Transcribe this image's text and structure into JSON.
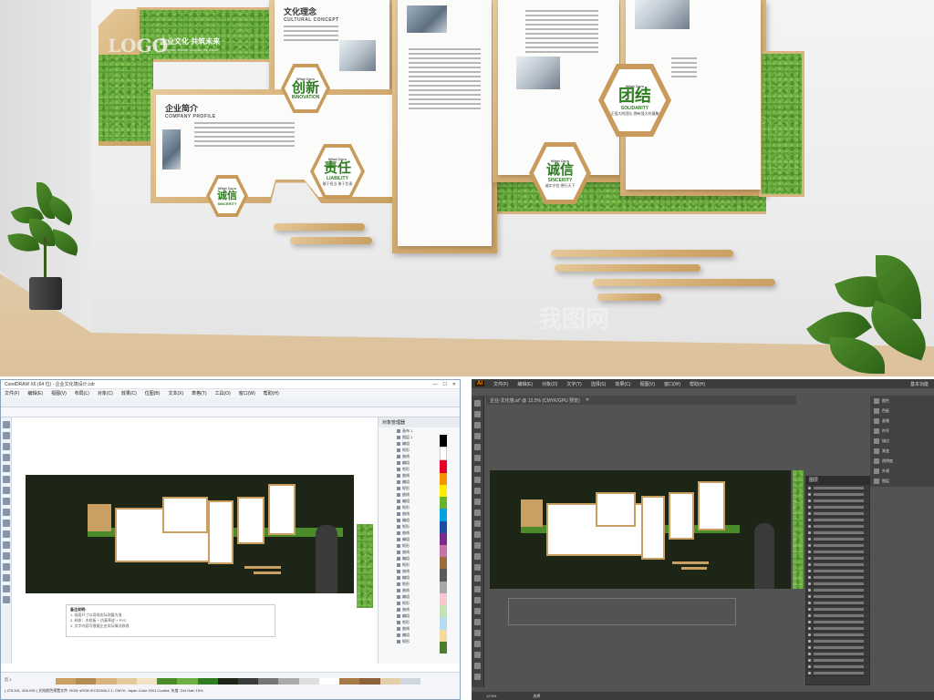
{
  "scene": {
    "logo_text": "LOGO",
    "banner_slogan": "企业文化 共筑未来",
    "banner_small": "Enterprise culture co-build the future",
    "culture_title_cn": "文化理念",
    "culture_title_en": "CULTURAL CONCEPT",
    "profile_title_cn": "企业简介",
    "profile_title_en": "COMPANY PROFILE",
    "hexes": [
      {
        "small": "What Ours",
        "main": "创新",
        "en": "INNOVATION",
        "sub": ""
      },
      {
        "small": "What Ours",
        "main": "责任",
        "en": "LIABILITY",
        "sub": "敢于担当 勇于负责"
      },
      {
        "small": "What Ours",
        "main": "诚信",
        "en": "SINCERITY",
        "sub": ""
      },
      {
        "small": "What Ours",
        "main": "诚信",
        "en": "SINCERITY",
        "sub": "诚实守信 德行天下"
      },
      {
        "small": "What Ours",
        "main": "团结",
        "en": "SOLIDARITY",
        "sub": "真正强大的团队 拥有强大的凝聚力"
      }
    ],
    "watermark": "我图网"
  },
  "corel": {
    "title": "CorelDRAW X6 (64 位) - 企业文化墙设计.cdr",
    "menu": [
      "文件(F)",
      "编辑(E)",
      "视图(V)",
      "布局(L)",
      "对象(C)",
      "效果(C)",
      "位图(B)",
      "文本(X)",
      "表格(T)",
      "工具(O)",
      "窗口(W)",
      "帮助(H)"
    ],
    "docker_title": "对象管理器",
    "docker_rows": [
      "画布 1",
      "图层 1",
      "编组",
      "矩形",
      "曲线",
      "编组",
      "矩形",
      "曲线",
      "编组",
      "矩形",
      "曲线",
      "编组",
      "矩形",
      "曲线",
      "编组",
      "矩形",
      "曲线",
      "编组",
      "矩形",
      "曲线",
      "编组",
      "矩形",
      "曲线",
      "编组",
      "矩形",
      "曲线",
      "编组",
      "矩形",
      "曲线",
      "编组",
      "矩形",
      "曲线",
      "编组",
      "矩形"
    ],
    "page_label": "页 1",
    "status": "( 475.301, 306.935 )   文档颜色预置文件: RGB: sRGB IEC61966-2.1; CMYK: Japan Color 2001 Coated; 灰度: Dot Gain 15%",
    "note_title": "备注说明:",
    "note_lines": [
      "1. 画面尺寸以现场实际测量为准",
      "2. 材质：木纹板 + 仿真草皮 + PVC",
      "3. 文字内容可根据企业实际情况修改"
    ]
  },
  "ai": {
    "menu": [
      "文件(F)",
      "编辑(E)",
      "对象(O)",
      "文字(T)",
      "选择(S)",
      "效果(C)",
      "视图(V)",
      "窗口(W)",
      "帮助(H)"
    ],
    "app_logo": "Ai",
    "workspace": "基本功能",
    "tab_title": "企业-文化墙.ai* @ 12.5% (CMYK/GPU 预览)",
    "right_panel": [
      "颜色",
      "色板",
      "画笔",
      "符号",
      "描边",
      "渐变",
      "透明度",
      "外观",
      "图层",
      "画板"
    ],
    "layers_title": "图层",
    "layer_count": 30,
    "zoom": "12.5%",
    "status": "选择"
  }
}
